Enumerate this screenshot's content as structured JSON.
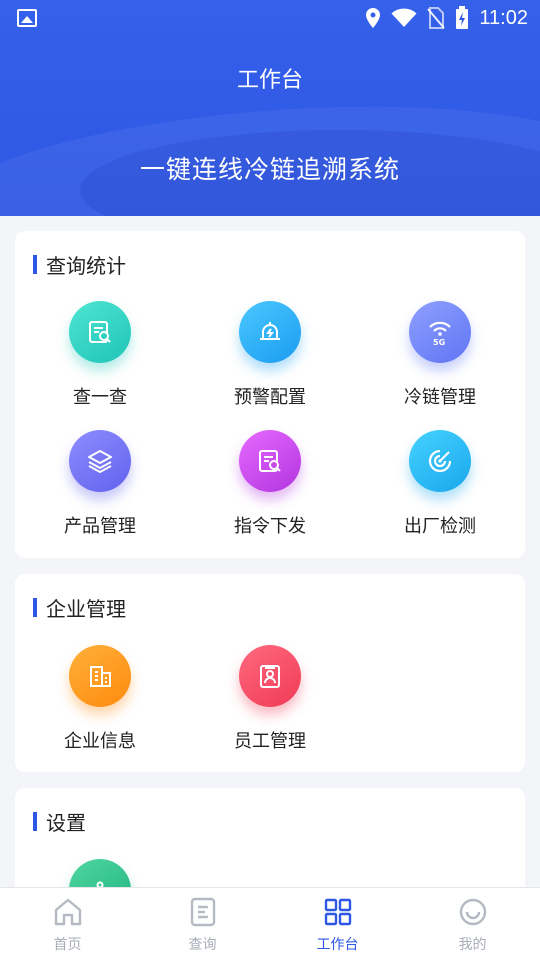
{
  "status_bar": {
    "time": "11:02"
  },
  "header": {
    "title": "工作台",
    "subtitle": "一键连线冷链追溯系统"
  },
  "sections": [
    {
      "title": "查询统计",
      "items": [
        {
          "label": "查一查",
          "icon": "search-doc-icon",
          "color": "#2cd0c0"
        },
        {
          "label": "预警配置",
          "icon": "bell-alert-icon",
          "color": "#28aef5"
        },
        {
          "label": "冷链管理",
          "icon": "wifi-5g-icon",
          "color": "#7286f8"
        },
        {
          "label": "产品管理",
          "icon": "layers-icon",
          "color": "#7373f3"
        },
        {
          "label": "指令下发",
          "icon": "command-doc-icon",
          "color": "#c94ae8"
        },
        {
          "label": "出厂检测",
          "icon": "radar-icon",
          "color": "#2cb6f0"
        }
      ]
    },
    {
      "title": "企业管理",
      "items": [
        {
          "label": "企业信息",
          "icon": "building-icon",
          "color": "#ff9a20"
        },
        {
          "label": "员工管理",
          "icon": "employee-card-icon",
          "color": "#f44a64"
        }
      ]
    },
    {
      "title": "设置",
      "items": [
        {
          "label": "",
          "icon": "settings-icon",
          "color": "#26bf88"
        }
      ]
    }
  ],
  "tabbar": {
    "items": [
      {
        "label": "首页",
        "icon": "home-icon",
        "active": false
      },
      {
        "label": "查询",
        "icon": "query-icon",
        "active": false
      },
      {
        "label": "工作台",
        "icon": "grid-icon",
        "active": true
      },
      {
        "label": "我的",
        "icon": "smile-icon",
        "active": false
      }
    ]
  }
}
